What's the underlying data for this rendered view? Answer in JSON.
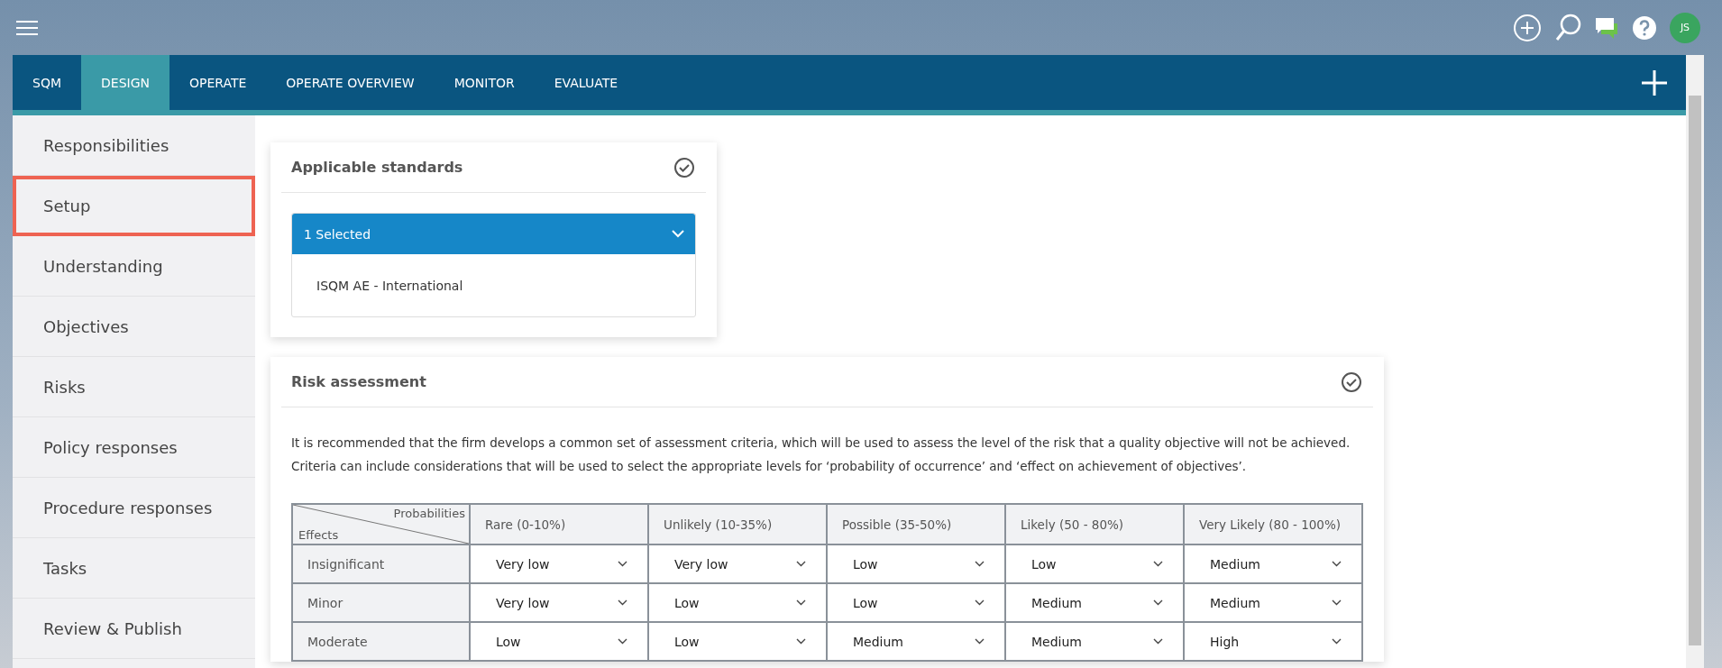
{
  "topbar": {
    "avatar": "JS"
  },
  "tabs": [
    {
      "label": "SQM",
      "selected": false
    },
    {
      "label": "DESIGN",
      "selected": true
    },
    {
      "label": "OPERATE",
      "selected": false
    },
    {
      "label": "OPERATE OVERVIEW",
      "selected": false
    },
    {
      "label": "MONITOR",
      "selected": false
    },
    {
      "label": "EVALUATE",
      "selected": false
    }
  ],
  "sidebar": {
    "items": [
      {
        "label": "Responsibilities",
        "highlighted": false
      },
      {
        "label": "Setup",
        "highlighted": true
      },
      {
        "label": "Understanding",
        "highlighted": false
      },
      {
        "label": "Objectives",
        "highlighted": false
      },
      {
        "label": "Risks",
        "highlighted": false
      },
      {
        "label": "Policy responses",
        "highlighted": false
      },
      {
        "label": "Procedure responses",
        "highlighted": false
      },
      {
        "label": "Tasks",
        "highlighted": false
      },
      {
        "label": "Review & Publish",
        "highlighted": false
      }
    ]
  },
  "standards_card": {
    "title": "Applicable standards",
    "dropdown": "1 Selected",
    "options": [
      "ISQM AE - International"
    ]
  },
  "risk_card": {
    "title": "Risk assessment",
    "description": "It is recommended that the firm develops a common set of assessment criteria, which will be used to assess the level of the risk that a quality objective will not be achieved. Criteria can include considerations that will be used to select the appropriate levels for ‘probability of occurrence’ and ‘effect on achievement of objectives’.",
    "table": {
      "corner_top": "Probabilities",
      "corner_bottom": "Effects",
      "columns": [
        "Rare (0-10%)",
        "Unlikely (10-35%)",
        "Possible (35-50%)",
        "Likely (50 - 80%)",
        "Very Likely (80 - 100%)"
      ],
      "rows": [
        {
          "effect": "Insignificant",
          "values": [
            "Very low",
            "Very low",
            "Low",
            "Low",
            "Medium"
          ]
        },
        {
          "effect": "Minor",
          "values": [
            "Very low",
            "Low",
            "Low",
            "Medium",
            "Medium"
          ]
        },
        {
          "effect": "Moderate",
          "values": [
            "Low",
            "Low",
            "Medium",
            "Medium",
            "High"
          ]
        }
      ]
    }
  }
}
